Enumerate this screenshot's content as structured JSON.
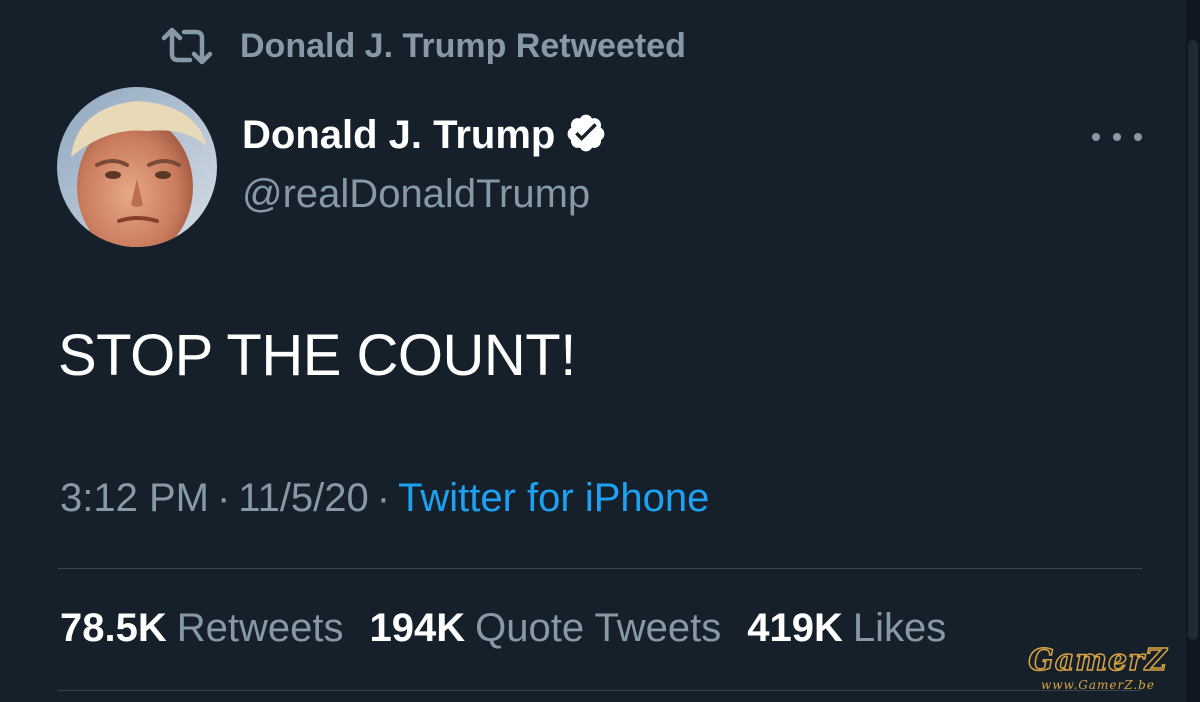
{
  "social_context": {
    "icon": "retweet-icon",
    "text": "Donald J. Trump Retweeted"
  },
  "author": {
    "name": "Donald J. Trump",
    "handle": "@realDonaldTrump",
    "verified": true,
    "avatar": "profile-photo"
  },
  "tweet": {
    "text": "STOP THE COUNT!",
    "time": "3:12 PM",
    "separator": "·",
    "date": "11/5/20",
    "source": "Twitter for iPhone"
  },
  "stats": {
    "retweets_count": "78.5K",
    "retweets_label": "Retweets",
    "quotes_count": "194K",
    "quotes_label": "Quote Tweets",
    "likes_count": "419K",
    "likes_label": "Likes"
  },
  "watermark": {
    "logo": "GamerZ",
    "url": "www.GamerZ.be"
  },
  "colors": {
    "background": "#15202b",
    "primary_text": "#ffffff",
    "secondary_text": "#8899a6",
    "link": "#1da1f2",
    "divider": "#38444d"
  }
}
